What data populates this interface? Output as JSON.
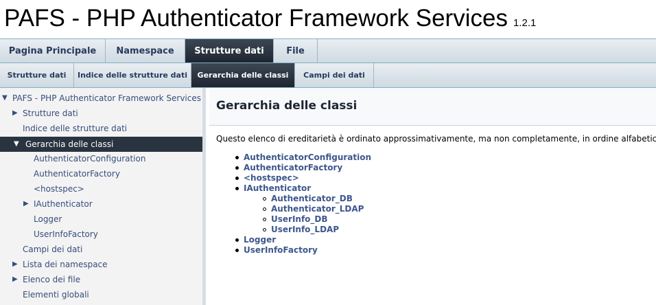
{
  "header": {
    "title": "PAFS - PHP Authenticator Framework Services",
    "version": "1.2.1"
  },
  "tabs_main": [
    {
      "label": "Pagina Principale"
    },
    {
      "label": "Namespace"
    },
    {
      "label": "Strutture dati",
      "active": true
    },
    {
      "label": "File"
    }
  ],
  "tabs_sub": [
    {
      "label": "Strutture dati"
    },
    {
      "label": "Indice delle strutture dati"
    },
    {
      "label": "Gerarchia delle classi",
      "active": true
    },
    {
      "label": "Campi dei dati"
    }
  ],
  "sidebar": {
    "items": [
      {
        "label": "PAFS - PHP Authenticator Framework Services",
        "expanded": true
      },
      {
        "label": "Strutture dati",
        "expandable": true
      },
      {
        "label": "Indice delle strutture dati"
      },
      {
        "label": "Gerarchia delle classi",
        "expanded": true,
        "selected": true
      },
      {
        "label": "AuthenticatorConfiguration"
      },
      {
        "label": "AuthenticatorFactory"
      },
      {
        "label": "<hostspec>"
      },
      {
        "label": "IAuthenticator",
        "expandable": true
      },
      {
        "label": "Logger"
      },
      {
        "label": "UserInfoFactory"
      },
      {
        "label": "Campi dei dati"
      },
      {
        "label": "Lista dei namespace",
        "expandable": true
      },
      {
        "label": "Elenco dei file",
        "expandable": true
      },
      {
        "label": "Elementi globali"
      }
    ]
  },
  "content": {
    "heading": "Gerarchia delle classi",
    "intro": "Questo elenco di ereditarietà è ordinato approssimativamente, ma non completamente, in ordine alfabetico:",
    "hierarchy": [
      {
        "label": "AuthenticatorConfiguration",
        "level": 0
      },
      {
        "label": "AuthenticatorFactory",
        "level": 0
      },
      {
        "label": "<hostspec>",
        "level": 0
      },
      {
        "label": "IAuthenticator",
        "level": 0
      },
      {
        "label": "Authenticator_DB",
        "level": 1
      },
      {
        "label": "Authenticator_LDAP",
        "level": 1
      },
      {
        "label": "UserInfo_DB",
        "level": 1
      },
      {
        "label": "UserInfo_LDAP",
        "level": 1
      },
      {
        "label": "Logger",
        "level": 0
      },
      {
        "label": "UserInfoFactory",
        "level": 0
      }
    ]
  }
}
